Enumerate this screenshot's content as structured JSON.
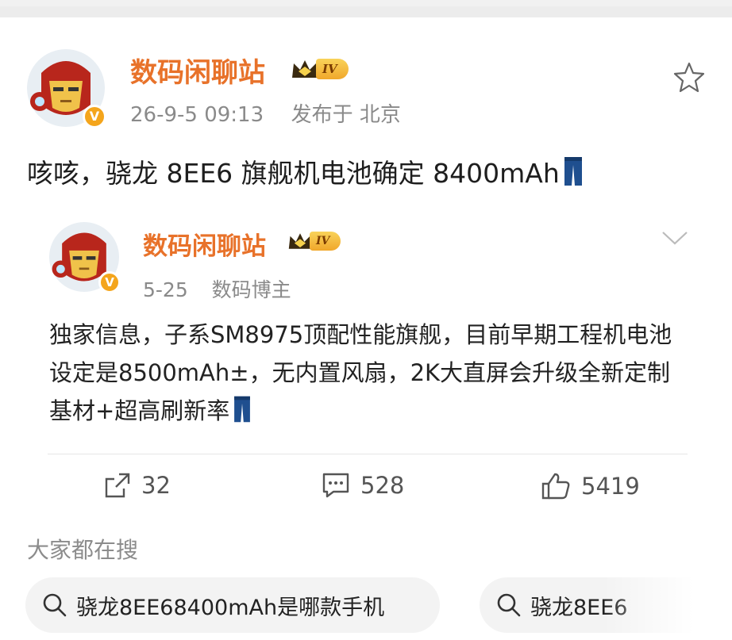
{
  "post": {
    "author": "数码闲聊站",
    "rank_badge": "IV",
    "timestamp": "26-9-5 09:13",
    "location": "发布于 北京",
    "text": "咳咳，骁龙 8EE6 旗舰机电池确定 8400mAh",
    "emoji_icon": "jeans-icon"
  },
  "repost": {
    "author": "数码闲聊站",
    "rank_badge": "IV",
    "date": "5-25",
    "role": "数码博主",
    "text": "独家信息，子系SM8975顶配性能旗舰，目前早期工程机电池设定是8500mAh±，无内置风扇，2K大直屏会升级全新定制基材+超高刷新率"
  },
  "actions": {
    "shares": "32",
    "comments": "528",
    "likes": "5419"
  },
  "search": {
    "title": "大家都在搜",
    "chips": [
      "骁龙8EE68400mAh是哪款手机",
      "骁龙8EE6"
    ]
  },
  "colors": {
    "name": "#e8722a",
    "verified": "#f4a51c",
    "chip_bg": "#f3f3f3"
  }
}
